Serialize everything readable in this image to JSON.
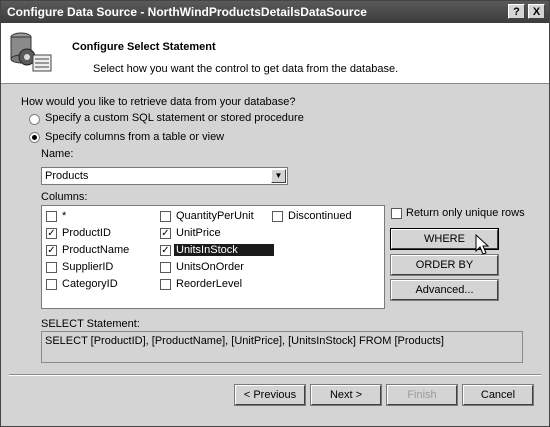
{
  "window": {
    "title": "Configure Data Source - NorthWindProductsDetailsDataSource",
    "help_btn": "?",
    "close_btn": "X"
  },
  "header": {
    "title": "Configure Select Statement",
    "subtitle": "Select how you want the control to get data from the database.",
    "icon": "database-gear-icon"
  },
  "question": "How would you like to retrieve data from your database?",
  "options": [
    {
      "label": "Specify a custom SQL statement or stored procedure",
      "selected": false
    },
    {
      "label": "Specify columns from a table or view",
      "selected": true
    }
  ],
  "name_label": "Name:",
  "table": {
    "selected": "Products"
  },
  "columns_label": "Columns:",
  "columns": [
    {
      "name": "*",
      "checked": false
    },
    {
      "name": "ProductID",
      "checked": true
    },
    {
      "name": "ProductName",
      "checked": true
    },
    {
      "name": "SupplierID",
      "checked": false
    },
    {
      "name": "CategoryID",
      "checked": false
    },
    {
      "name": "QuantityPerUnit",
      "checked": false
    },
    {
      "name": "UnitPrice",
      "checked": true
    },
    {
      "name": "UnitsInStock",
      "checked": true,
      "highlighted": true
    },
    {
      "name": "UnitsOnOrder",
      "checked": false
    },
    {
      "name": "ReorderLevel",
      "checked": false
    },
    {
      "name": "Discontinued",
      "checked": false
    }
  ],
  "unique_rows": {
    "label": "Return only unique rows",
    "checked": false
  },
  "side_buttons": {
    "where": "WHERE",
    "order_by": "ORDER BY",
    "advanced": "Advanced..."
  },
  "sql_label": "SELECT Statement:",
  "sql": "SELECT [ProductID], [ProductName], [UnitPrice], [UnitsInStock] FROM [Products]",
  "footer": {
    "previous": "< Previous",
    "next": "Next >",
    "finish": "Finish",
    "cancel": "Cancel"
  },
  "colors": {
    "titlebar": "#3c3c3c",
    "dialog_bg": "#d4d4d4",
    "selection": "#1a1a1a"
  }
}
